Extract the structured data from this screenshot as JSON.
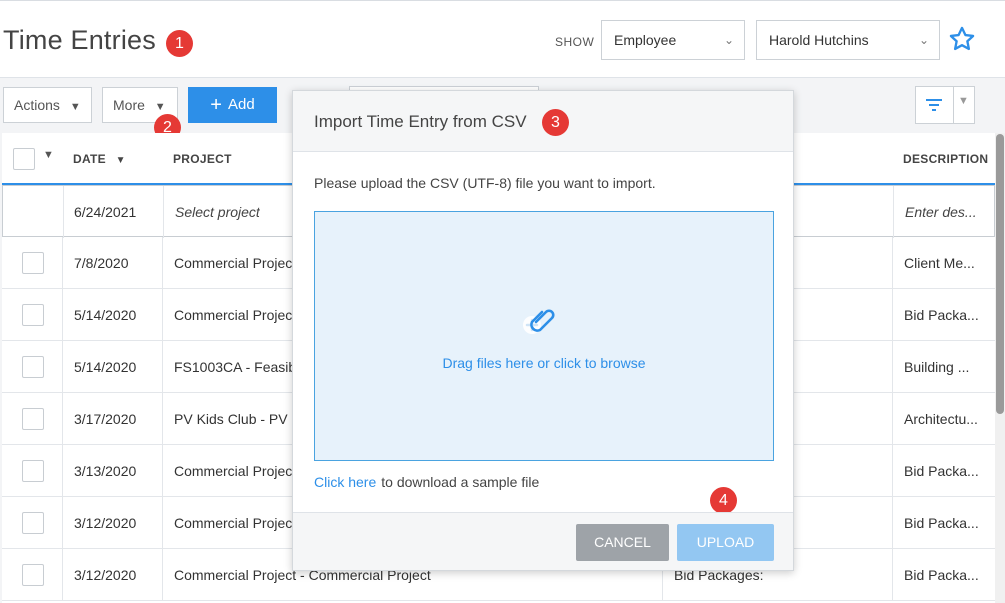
{
  "header": {
    "title": "Time Entries",
    "show_label": "SHOW",
    "show_select": "Employee",
    "employee_select": "Harold Hutchins"
  },
  "badges": [
    "1",
    "2",
    "3",
    "4"
  ],
  "toolbar": {
    "actions_label": "Actions",
    "more_label": "More",
    "add_label": "Add"
  },
  "table": {
    "columns": [
      "DATE",
      "PROJECT",
      "DESCRIPTION"
    ],
    "rows": [
      {
        "date": "6/24/2021",
        "project": "Select project",
        "mid": "",
        "description": "Enter des..."
      },
      {
        "date": "7/8/2020",
        "project": "Commercial Project",
        "mid": "",
        "description": "Client Me..."
      },
      {
        "date": "5/14/2020",
        "project": "Commercial Project",
        "mid": "",
        "description": "Bid Packa..."
      },
      {
        "date": "5/14/2020",
        "project": "FS1003CA - Feasib",
        "mid": "",
        "description": "Building ..."
      },
      {
        "date": "3/17/2020",
        "project": "PV Kids Club - PV K",
        "mid": "",
        "description": "Architectu..."
      },
      {
        "date": "3/13/2020",
        "project": "Commercial Project",
        "mid": "",
        "description": "Bid Packa..."
      },
      {
        "date": "3/12/2020",
        "project": "Commercial Project",
        "mid": "",
        "description": "Bid Packa..."
      },
      {
        "date": "3/12/2020",
        "project": "Commercial Project - Commercial Project",
        "mid": "Bid Packages:",
        "description": "Bid Packa..."
      }
    ]
  },
  "modal": {
    "title": "Import Time Entry from CSV",
    "instruction": "Please upload the CSV (UTF-8) file you want to import.",
    "drop_text": "Drag files here or click to browse",
    "sample_link": "Click here",
    "sample_text": "to download a sample file",
    "cancel_label": "CANCEL",
    "upload_label": "UPLOAD"
  },
  "colors": {
    "accent": "#2d8fe8",
    "badge": "#e53935",
    "dropzone_bg": "#e7f2fb",
    "upload_disabled": "#93c7f2",
    "cancel": "#9ea3a8"
  },
  "icons": [
    "star-icon",
    "filter-icon",
    "paperclip-icon",
    "plus-icon",
    "chevron-down-icon"
  ]
}
